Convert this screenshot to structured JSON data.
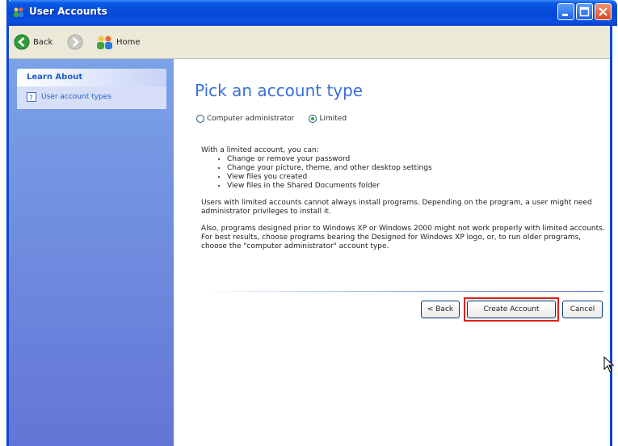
{
  "window": {
    "title": "User Accounts",
    "titlebar_color": "#0548d8"
  },
  "toolbar": {
    "back_label": "Back",
    "home_label": "Home"
  },
  "sidebar": {
    "panel_title": "Learn About",
    "link_label": "User account types"
  },
  "main": {
    "heading": "Pick an account type",
    "options": [
      {
        "label": "Computer administrator",
        "checked": false
      },
      {
        "label": "Limited",
        "checked": true
      }
    ],
    "intro": "With a limited account, you can:",
    "bullets": [
      "Change or remove your password",
      "Change your picture, theme, and other desktop settings",
      "View files you created",
      "View files in the Shared Documents folder"
    ],
    "para1": "Users with limited accounts cannot always install programs. Depending on the program, a user might need administrator privileges to install it.",
    "para2": "Also, programs designed prior to Windows XP or Windows 2000 might not work properly with limited accounts. For best results, choose programs bearing the Designed for Windows XP logo, or, to run older programs, choose the \"computer administrator\" account type.",
    "buttons": {
      "back": "< Back",
      "create": "Create Account",
      "cancel": "Cancel"
    },
    "highlight_color": "#e0201c"
  }
}
